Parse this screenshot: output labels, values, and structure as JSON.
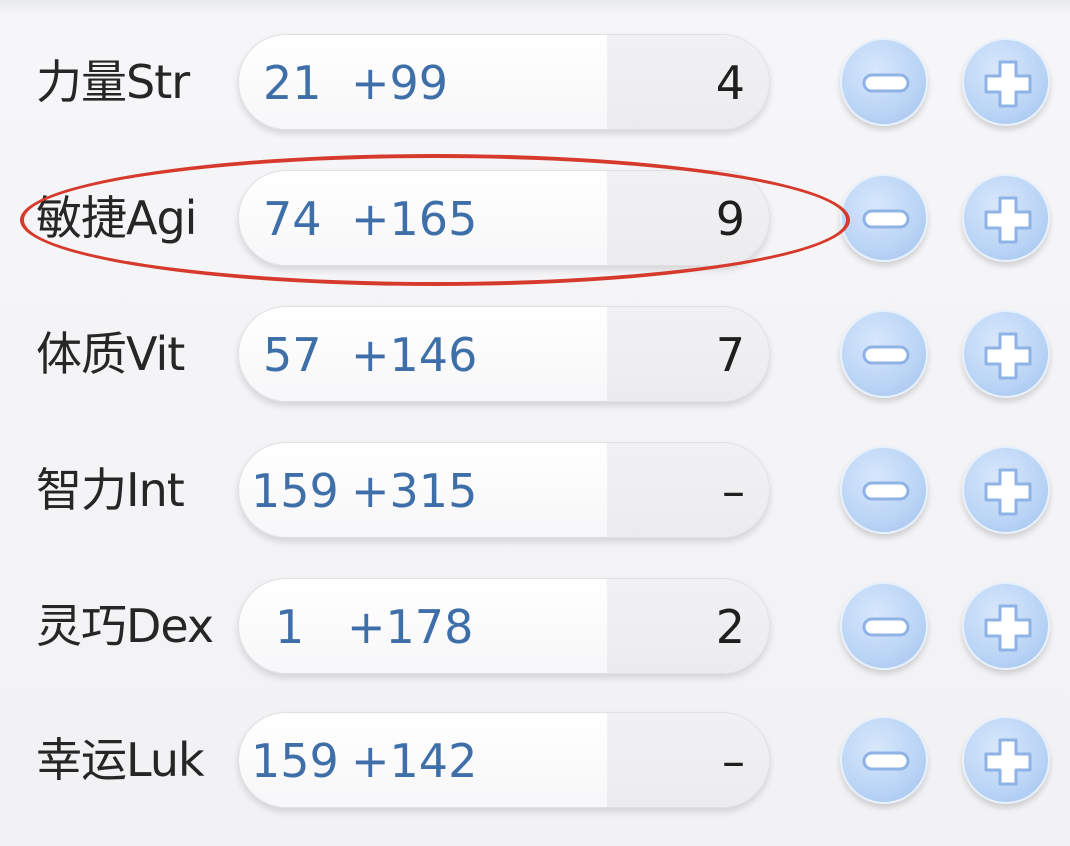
{
  "stats": [
    {
      "label": "力量Str",
      "base": "21",
      "bonus": "+99",
      "cost": "4"
    },
    {
      "label": "敏捷Agi",
      "base": "74",
      "bonus": "+165",
      "cost": "9"
    },
    {
      "label": "体质Vit",
      "base": "57",
      "bonus": "+146",
      "cost": "7"
    },
    {
      "label": "智力Int",
      "base": "159",
      "bonus": "+315",
      "cost": "–"
    },
    {
      "label": "灵巧Dex",
      "base": "1",
      "bonus": "+178",
      "cost": "2"
    },
    {
      "label": "幸运Luk",
      "base": "159",
      "bonus": "+142",
      "cost": "–"
    }
  ],
  "icons": {
    "decrease": "minus-circle-icon",
    "increase": "plus-circle-icon"
  },
  "colors": {
    "value": "#3f6fa8",
    "button": "#bcd6f6",
    "annotation": "#d63a2c"
  },
  "highlighted_stat": "敏捷Agi"
}
